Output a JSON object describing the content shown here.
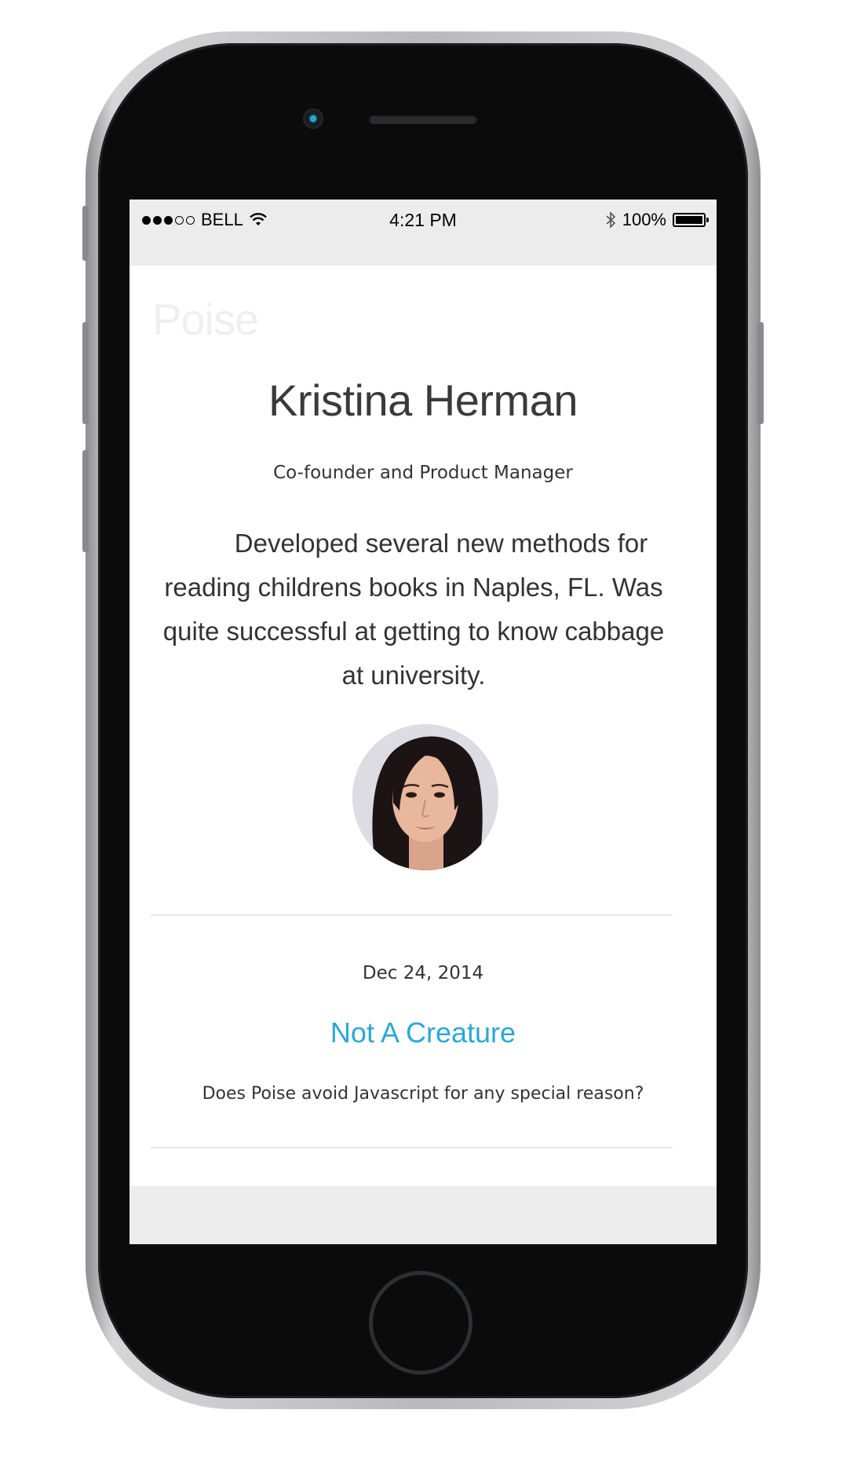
{
  "status_bar": {
    "carrier": "BELL",
    "time": "4:21 PM",
    "battery": "100%",
    "signal_strength": "3 of 5",
    "icons": [
      "wifi-icon",
      "bluetooth-icon",
      "battery-icon"
    ]
  },
  "site": {
    "brand": "Poise"
  },
  "profile": {
    "name": "Kristina Herman",
    "role": "Co-founder and Product Manager",
    "bio": "Developed several new methods for reading childrens books in Naples, FL. Was quite successful at getting to know cabbage at university."
  },
  "post": {
    "date": "Dec 24, 2014",
    "title": "Not A Creature",
    "excerpt": "Does Poise avoid Javascript for any special reason?"
  },
  "colors": {
    "link": "#2aa8d8",
    "brand_watermark": "#efefef",
    "status_bar_bg": "#ececec"
  }
}
